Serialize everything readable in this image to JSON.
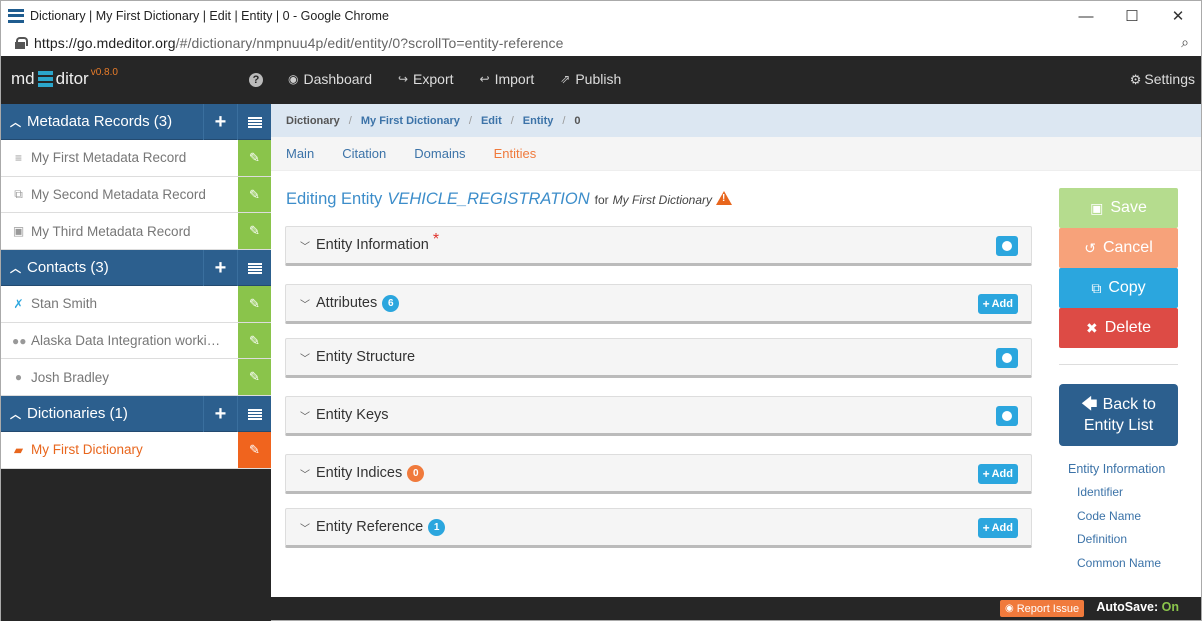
{
  "window": {
    "title": "Dictionary | My First Dictionary | Edit | Entity | 0 - Google Chrome",
    "minimize": "—",
    "maximize": "☐",
    "close": "✕"
  },
  "address": {
    "host": "https://go.mdeditor.org",
    "path": "/#/dictionary/nmpnuu4p/edit/entity/0?scrollTo=entity-reference",
    "zoom_icon": "zoom-icon"
  },
  "brand": {
    "pre": "md",
    "post": "ditor",
    "version": "v0.8.0"
  },
  "topnav": [
    {
      "icon": "dashboard-icon",
      "glyph": "◉",
      "label": "Dashboard"
    },
    {
      "icon": "export-icon",
      "glyph": "↪",
      "label": "Export"
    },
    {
      "icon": "import-icon",
      "glyph": "↩",
      "label": "Import"
    },
    {
      "icon": "publish-icon",
      "glyph": "⇗",
      "label": "Publish"
    }
  ],
  "settings": {
    "glyph": "⚙",
    "label": "Settings"
  },
  "sidebar": {
    "sections": [
      {
        "title": "Metadata Records (3)",
        "items": [
          {
            "icon": "database-icon",
            "glyph": "≡",
            "label": "My First Metadata Record"
          },
          {
            "icon": "copy-record-icon",
            "glyph": "⧉",
            "label": "My Second Metadata Record"
          },
          {
            "icon": "image-icon",
            "glyph": "▣",
            "label": "My Third Metadata Record"
          }
        ]
      },
      {
        "title": "Contacts (3)",
        "items": [
          {
            "icon": "person-running-icon",
            "glyph": "✗",
            "label": "Stan Smith"
          },
          {
            "icon": "group-icon",
            "glyph": "👥",
            "label": "Alaska Data Integration working group"
          },
          {
            "icon": "user-icon",
            "glyph": "●",
            "label": "Josh Bradley"
          }
        ]
      },
      {
        "title": "Dictionaries (1)",
        "items": [
          {
            "icon": "book-icon",
            "glyph": "▰",
            "label": "My First Dictionary"
          }
        ]
      }
    ]
  },
  "breadcrumb": [
    "Dictionary",
    "My First Dictionary",
    "Edit",
    "Entity",
    "0"
  ],
  "tabs": [
    "Main",
    "Citation",
    "Domains",
    "Entities"
  ],
  "heading": {
    "prefix": "Editing Entity",
    "entity": "VEHICLE_REGISTRATION",
    "for": "for",
    "dictionary": "My First Dictionary"
  },
  "panels": [
    {
      "title": "Entity Information",
      "required": "*"
    },
    {
      "title": "Attributes",
      "count": "6",
      "add": "Add"
    },
    {
      "title": "Entity Structure"
    },
    {
      "title": "Entity Keys"
    },
    {
      "title": "Entity Indices",
      "count": "0",
      "add": "Add"
    },
    {
      "title": "Entity Reference",
      "count": "1",
      "add": "Add"
    }
  ],
  "actions": {
    "save": "Save",
    "cancel": "Cancel",
    "copy": "Copy",
    "delete": "Delete",
    "back_line1": "Back to",
    "back_line2": "Entity List"
  },
  "toc": {
    "heading": "Entity Information",
    "items": [
      "Identifier",
      "Code Name",
      "Definition",
      "Common Name"
    ]
  },
  "footer": {
    "report": "Report Issue",
    "autosave_label": "AutoSave:",
    "autosave_value": "On"
  },
  "colors": {
    "brand_blue": "#2c5f8e",
    "accent_orange": "#f07a3c",
    "edit_green": "#8ac44b",
    "info_blue": "#2ba6de",
    "danger_red": "#dd4b45"
  }
}
